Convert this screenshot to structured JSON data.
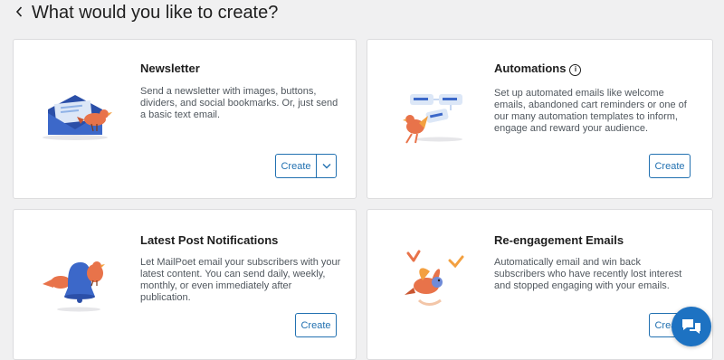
{
  "header": {
    "back_icon": "chevron-left-icon",
    "title": "What would you like to create?"
  },
  "cards": {
    "newsletter": {
      "title": "Newsletter",
      "description": "Send a newsletter with images, buttons, dividers, and social bookmarks. Or, just send a basic text email.",
      "button_label": "Create",
      "dropdown_icon": "chevron-down-icon",
      "illustration_icon": "envelope-bird-icon"
    },
    "automations": {
      "title": "Automations",
      "info_icon": "info-icon",
      "info_glyph": "i",
      "description": "Set up automated emails like welcome emails, abandoned cart reminders or one of our many automation templates to inform, engage and reward your audience.",
      "button_label": "Create",
      "illustration_icon": "workflow-bird-icon"
    },
    "post_notifications": {
      "title": "Latest Post Notifications",
      "description": "Let MailPoet email your subscribers with your latest content. You can send daily, weekly, monthly, or even immediately after publication.",
      "button_label": "Create",
      "illustration_icon": "bell-bird-icon"
    },
    "reengagement": {
      "title": "Re-engagement Emails",
      "description": "Automatically email and win back subscribers who have recently lost interest and stopped engaging with your emails.",
      "button_label": "Create",
      "illustration_icon": "flying-birds-icon"
    }
  },
  "chat": {
    "icon": "chat-bubbles-icon"
  },
  "colors": {
    "accent": "#2271b1",
    "chat_bg": "#1d72c2",
    "background": "#f0f0f1"
  }
}
